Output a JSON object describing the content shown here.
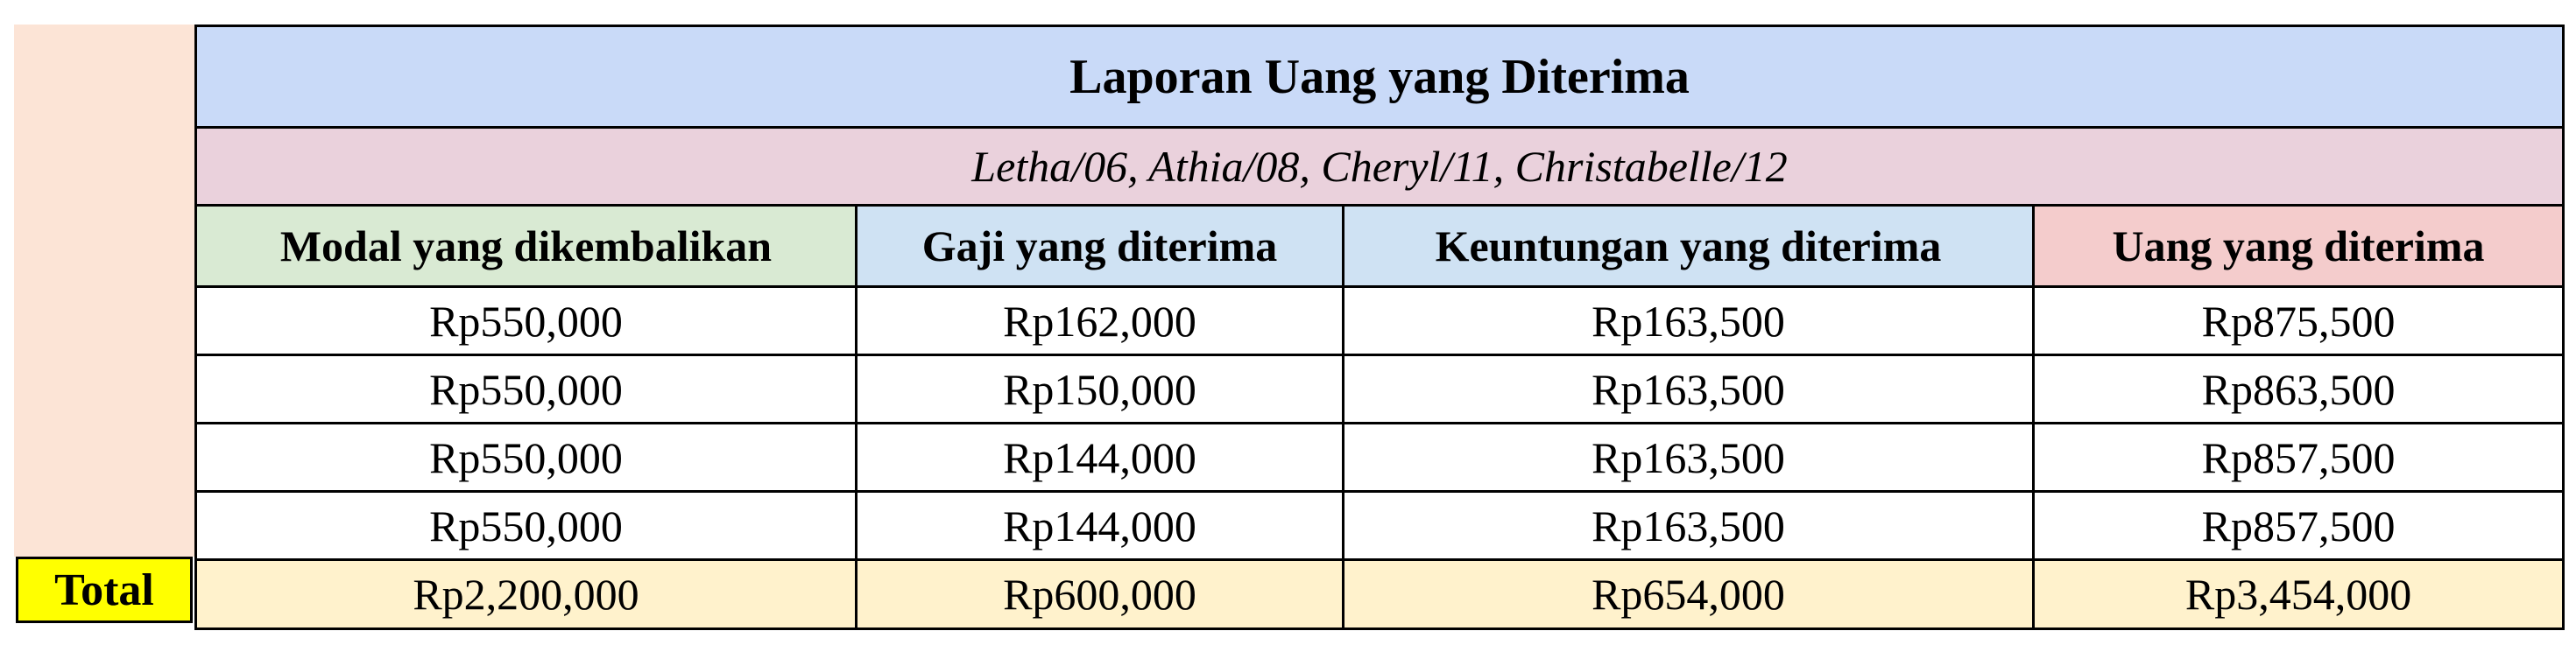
{
  "report": {
    "title": "Laporan Uang yang Diterima",
    "subtitle": "Letha/06, Athia/08, Cheryl/11, Christabelle/12",
    "columns": [
      "Modal yang dikembalikan",
      "Gaji yang diterima",
      "Keuntungan yang diterima",
      "Uang yang diterima"
    ],
    "rows": [
      [
        "Rp550,000",
        "Rp162,000",
        "Rp163,500",
        "Rp875,500"
      ],
      [
        "Rp550,000",
        "Rp150,000",
        "Rp163,500",
        "Rp863,500"
      ],
      [
        "Rp550,000",
        "Rp144,000",
        "Rp163,500",
        "Rp857,500"
      ],
      [
        "Rp550,000",
        "Rp144,000",
        "Rp163,500",
        "Rp857,500"
      ]
    ],
    "total_label": "Total",
    "totals": [
      "Rp2,200,000",
      "Rp600,000",
      "Rp654,000",
      "Rp3,454,000"
    ]
  },
  "colors": {
    "title_bg": "#c9daf8",
    "subtitle_bg": "#ead1dc",
    "header_green": "#d9ead3",
    "header_blue": "#cfe2f3",
    "header_red": "#f4cccc",
    "side_block": "#fce4d6",
    "total_label_bg": "#ffff00",
    "total_row_bg": "#fff2cc"
  }
}
